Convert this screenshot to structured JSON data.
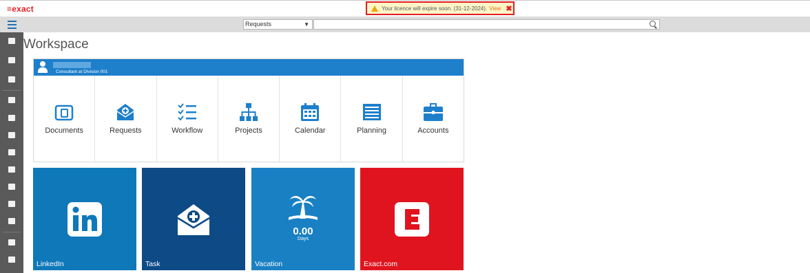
{
  "app": {
    "logo": "≡exact"
  },
  "notice": {
    "text": "Your licence will expire soon. (31-12-2024).",
    "link": "View",
    "close": "✖"
  },
  "search": {
    "selected": "Requests",
    "placeholder": "",
    "value": ""
  },
  "page": {
    "title": "Workspace"
  },
  "user": {
    "name": "",
    "role": "Consultant at Division 001"
  },
  "apps": [
    {
      "label": "Documents",
      "icon": "folder-icon"
    },
    {
      "label": "Requests",
      "icon": "request-envelope-icon"
    },
    {
      "label": "Workflow",
      "icon": "checklist-icon"
    },
    {
      "label": "Projects",
      "icon": "hierarchy-icon"
    },
    {
      "label": "Calendar",
      "icon": "calendar-icon"
    },
    {
      "label": "Planning",
      "icon": "planning-list-icon"
    },
    {
      "label": "Accounts",
      "icon": "briefcase-icon"
    }
  ],
  "tiles": [
    {
      "label": "LinkedIn",
      "color": "#0e78b9",
      "icon": "linkedin-icon"
    },
    {
      "label": "Task",
      "color": "#0d4a86",
      "icon": "task-envelope-icon"
    },
    {
      "label": "Vacation",
      "color": "#1a80c4",
      "icon": "palm-tree-icon",
      "value": "0.00",
      "unit": "Days"
    },
    {
      "label": "Exact.com",
      "color": "#e0141e",
      "icon": "exact-logo-icon"
    }
  ],
  "colors": {
    "accent": "#1e7fcb",
    "sidebar": "#5a5a5a",
    "brand": "#e31e24"
  }
}
